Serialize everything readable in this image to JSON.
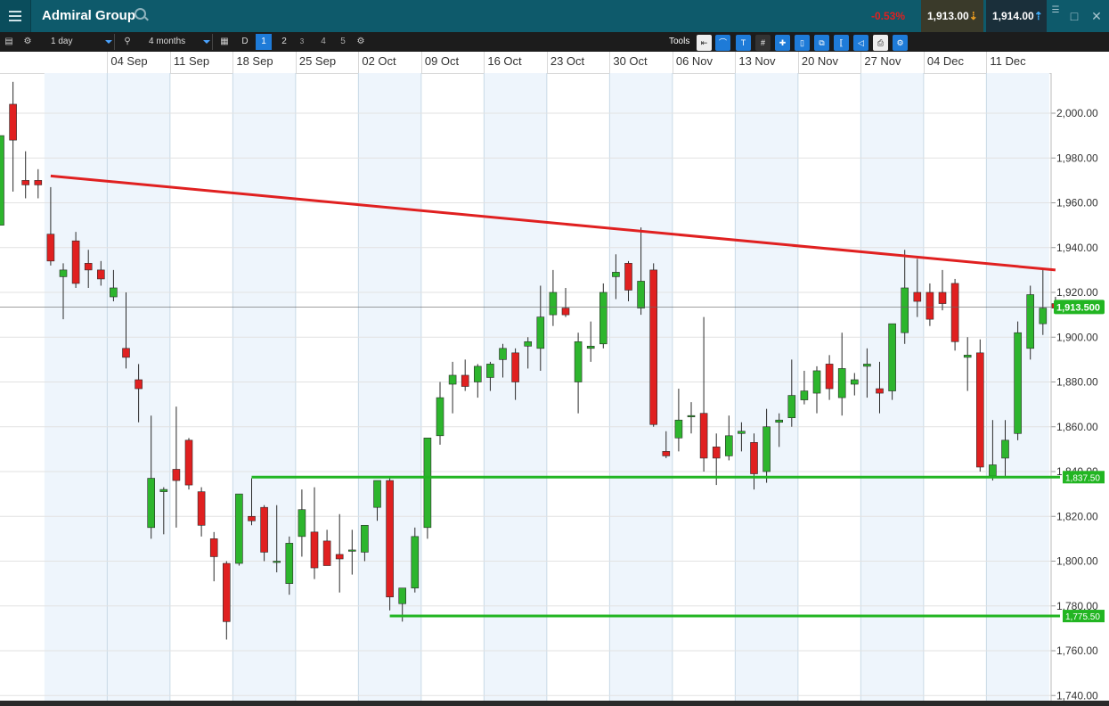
{
  "header": {
    "title": "Admiral Group",
    "change_pct": "-0.53%",
    "sell_price": "1,913.00",
    "buy_price": "1,914.00"
  },
  "toolbar": {
    "interval": "1 day",
    "period": "4 months",
    "chart_type": "D",
    "layouts": [
      "1",
      "2",
      "3",
      "4",
      "5"
    ],
    "active_layout": "1",
    "tools_label": "Tools"
  },
  "colors": {
    "header_bg": "#0e5a6b",
    "up_candle": "#2db52d",
    "down_candle": "#e02020",
    "resistance_line": "#e02020",
    "support_line": "#22b522",
    "price_tag": "#22b522"
  },
  "chart_data": {
    "type": "candlestick",
    "x_tick_labels": [
      "04 Sep",
      "11 Sep",
      "18 Sep",
      "25 Sep",
      "02 Oct",
      "09 Oct",
      "16 Oct",
      "23 Oct",
      "30 Oct",
      "06 Nov",
      "13 Nov",
      "20 Nov",
      "27 Nov",
      "04 Dec",
      "11 Dec"
    ],
    "y_ticks": [
      1740,
      1760,
      1780,
      1800,
      1820,
      1840,
      1860,
      1880,
      1900,
      1920,
      1940,
      1960,
      1980,
      2000
    ],
    "y_tick_labels": [
      "1,740.00",
      "1,760.00",
      "1,780.00",
      "1,800.00",
      "1,820.00",
      "1,840.00",
      "1,860.00",
      "1,880.00",
      "1,900.00",
      "1,920.00",
      "1,940.00",
      "1,960.00",
      "1,980.00",
      "2,000.00"
    ],
    "ylim": [
      1738,
      2019
    ],
    "grid": true,
    "current_price": 1913.5,
    "current_price_label": "1,913.500",
    "candles": [
      {
        "o": 1950,
        "h": 1968,
        "l": 1950,
        "c": 1990
      },
      {
        "o": 2004,
        "h": 2014,
        "l": 1965,
        "c": 1988
      },
      {
        "o": 1970,
        "h": 1983,
        "l": 1962,
        "c": 1968
      },
      {
        "o": 1970,
        "h": 1975,
        "l": 1962,
        "c": 1968
      },
      {
        "o": 1946,
        "h": 1967,
        "l": 1932,
        "c": 1934
      },
      {
        "o": 1927,
        "h": 1933,
        "l": 1908,
        "c": 1930
      },
      {
        "o": 1943,
        "h": 1947,
        "l": 1922,
        "c": 1924
      },
      {
        "o": 1933,
        "h": 1939,
        "l": 1922,
        "c": 1930
      },
      {
        "o": 1930,
        "h": 1934,
        "l": 1923,
        "c": 1926
      },
      {
        "o": 1918,
        "h": 1930,
        "l": 1916,
        "c": 1922
      },
      {
        "o": 1895,
        "h": 1920,
        "l": 1886,
        "c": 1891
      },
      {
        "o": 1881,
        "h": 1888,
        "l": 1862,
        "c": 1877
      },
      {
        "o": 1815,
        "h": 1865,
        "l": 1810,
        "c": 1837
      },
      {
        "o": 1831,
        "h": 1833,
        "l": 1812,
        "c": 1832
      },
      {
        "o": 1841,
        "h": 1869,
        "l": 1815,
        "c": 1836
      },
      {
        "o": 1854,
        "h": 1855,
        "l": 1832,
        "c": 1834
      },
      {
        "o": 1831,
        "h": 1833,
        "l": 1811,
        "c": 1816
      },
      {
        "o": 1810,
        "h": 1813,
        "l": 1791,
        "c": 1802
      },
      {
        "o": 1799,
        "h": 1800,
        "l": 1765,
        "c": 1773
      },
      {
        "o": 1799,
        "h": 1830,
        "l": 1798,
        "c": 1830
      },
      {
        "o": 1820,
        "h": 1837,
        "l": 1816,
        "c": 1818
      },
      {
        "o": 1824,
        "h": 1825,
        "l": 1800,
        "c": 1804
      },
      {
        "o": 1800,
        "h": 1825,
        "l": 1795,
        "c": 1800
      },
      {
        "o": 1790,
        "h": 1811,
        "l": 1785,
        "c": 1808
      },
      {
        "o": 1811,
        "h": 1832,
        "l": 1802,
        "c": 1823
      },
      {
        "o": 1813,
        "h": 1833,
        "l": 1792,
        "c": 1797
      },
      {
        "o": 1809,
        "h": 1814,
        "l": 1799,
        "c": 1798
      },
      {
        "o": 1803,
        "h": 1821,
        "l": 1786,
        "c": 1801
      },
      {
        "o": 1805,
        "h": 1814,
        "l": 1794,
        "c": 1805
      },
      {
        "o": 1804,
        "h": 1811,
        "l": 1800,
        "c": 1816
      },
      {
        "o": 1824,
        "h": 1834,
        "l": 1818,
        "c": 1836
      },
      {
        "o": 1836,
        "h": 1837,
        "l": 1778,
        "c": 1784
      },
      {
        "o": 1781,
        "h": 1788,
        "l": 1773,
        "c": 1788
      },
      {
        "o": 1788,
        "h": 1815,
        "l": 1786,
        "c": 1811
      },
      {
        "o": 1815,
        "h": 1855,
        "l": 1810,
        "c": 1855
      },
      {
        "o": 1856,
        "h": 1880,
        "l": 1852,
        "c": 1873
      },
      {
        "o": 1879,
        "h": 1889,
        "l": 1866,
        "c": 1883
      },
      {
        "o": 1883,
        "h": 1890,
        "l": 1876,
        "c": 1878
      },
      {
        "o": 1880,
        "h": 1888,
        "l": 1873,
        "c": 1887
      },
      {
        "o": 1882,
        "h": 1889,
        "l": 1876,
        "c": 1888
      },
      {
        "o": 1890,
        "h": 1897,
        "l": 1882,
        "c": 1895
      },
      {
        "o": 1893,
        "h": 1895,
        "l": 1872,
        "c": 1880
      },
      {
        "o": 1896,
        "h": 1900,
        "l": 1886,
        "c": 1898
      },
      {
        "o": 1895,
        "h": 1923,
        "l": 1885,
        "c": 1909
      },
      {
        "o": 1910,
        "h": 1930,
        "l": 1905,
        "c": 1920
      },
      {
        "o": 1913,
        "h": 1922,
        "l": 1909,
        "c": 1910
      },
      {
        "o": 1880,
        "h": 1902,
        "l": 1866,
        "c": 1898
      },
      {
        "o": 1895,
        "h": 1907,
        "l": 1889,
        "c": 1896
      },
      {
        "o": 1897,
        "h": 1924,
        "l": 1895,
        "c": 1920
      },
      {
        "o": 1927,
        "h": 1937,
        "l": 1917,
        "c": 1929
      },
      {
        "o": 1933,
        "h": 1934,
        "l": 1916,
        "c": 1921
      },
      {
        "o": 1913,
        "h": 1949,
        "l": 1910,
        "c": 1925
      },
      {
        "o": 1930,
        "h": 1933,
        "l": 1860,
        "c": 1861
      },
      {
        "o": 1849,
        "h": 1858,
        "l": 1846,
        "c": 1847
      },
      {
        "o": 1855,
        "h": 1877,
        "l": 1849,
        "c": 1863
      },
      {
        "o": 1865,
        "h": 1871,
        "l": 1857,
        "c": 1865
      },
      {
        "o": 1866,
        "h": 1909,
        "l": 1840,
        "c": 1846
      },
      {
        "o": 1851,
        "h": 1857,
        "l": 1834,
        "c": 1846
      },
      {
        "o": 1847,
        "h": 1865,
        "l": 1845,
        "c": 1856
      },
      {
        "o": 1857,
        "h": 1862,
        "l": 1849,
        "c": 1858
      },
      {
        "o": 1853,
        "h": 1857,
        "l": 1832,
        "c": 1839
      },
      {
        "o": 1840,
        "h": 1868,
        "l": 1835,
        "c": 1860
      },
      {
        "o": 1862,
        "h": 1866,
        "l": 1851,
        "c": 1863
      },
      {
        "o": 1864,
        "h": 1890,
        "l": 1860,
        "c": 1874
      },
      {
        "o": 1872,
        "h": 1885,
        "l": 1870,
        "c": 1876
      },
      {
        "o": 1875,
        "h": 1887,
        "l": 1866,
        "c": 1885
      },
      {
        "o": 1888,
        "h": 1892,
        "l": 1872,
        "c": 1877
      },
      {
        "o": 1873,
        "h": 1902,
        "l": 1865,
        "c": 1886
      },
      {
        "o": 1879,
        "h": 1884,
        "l": 1874,
        "c": 1881
      },
      {
        "o": 1887,
        "h": 1895,
        "l": 1873,
        "c": 1888
      },
      {
        "o": 1877,
        "h": 1889,
        "l": 1866,
        "c": 1875
      },
      {
        "o": 1876,
        "h": 1904,
        "l": 1872,
        "c": 1906
      },
      {
        "o": 1902,
        "h": 1939,
        "l": 1897,
        "c": 1922
      },
      {
        "o": 1920,
        "h": 1935,
        "l": 1909,
        "c": 1916
      },
      {
        "o": 1920,
        "h": 1924,
        "l": 1905,
        "c": 1908
      },
      {
        "o": 1920,
        "h": 1930,
        "l": 1912,
        "c": 1915
      },
      {
        "o": 1924,
        "h": 1926,
        "l": 1894,
        "c": 1898
      },
      {
        "o": 1891,
        "h": 1900,
        "l": 1876,
        "c": 1892
      },
      {
        "o": 1893,
        "h": 1899,
        "l": 1840,
        "c": 1842
      },
      {
        "o": 1838,
        "h": 1863,
        "l": 1836,
        "c": 1843
      },
      {
        "o": 1846,
        "h": 1863,
        "l": 1838,
        "c": 1854
      },
      {
        "o": 1857,
        "h": 1907,
        "l": 1854,
        "c": 1902
      },
      {
        "o": 1895,
        "h": 1923,
        "l": 1890,
        "c": 1919
      },
      {
        "o": 1906,
        "h": 1930,
        "l": 1901,
        "c": 1913
      },
      {
        "o": 1915,
        "h": 1918,
        "l": 1911,
        "c": 1913
      }
    ],
    "annotations": [
      {
        "type": "trendline",
        "name": "resistance",
        "x_start": 4,
        "y_start": 1972,
        "x_end": 84,
        "y_end": 1930
      },
      {
        "type": "hline",
        "name": "support-upper",
        "value": 1837.5,
        "label": "1,837.50",
        "x_start": 20
      },
      {
        "type": "hline",
        "name": "support-lower",
        "value": 1775.5,
        "label": "1,775.50",
        "x_start": 31
      }
    ]
  }
}
